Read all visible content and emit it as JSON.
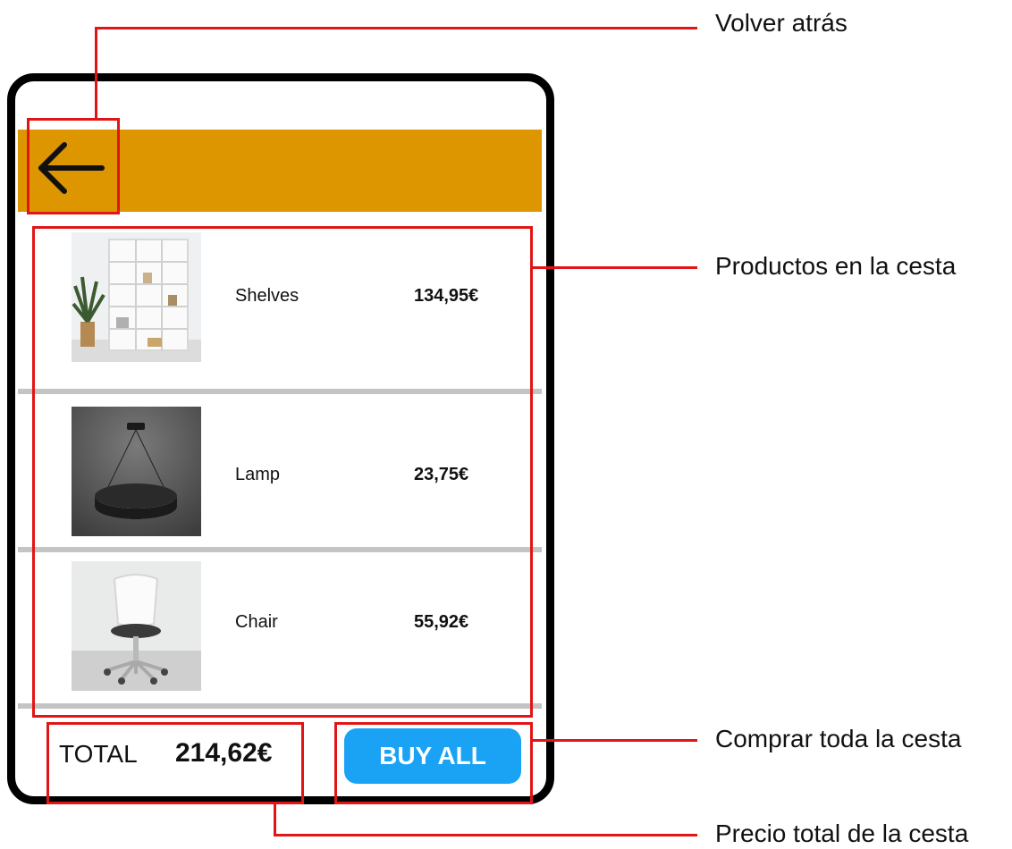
{
  "app": {
    "header_color": "#dd9500",
    "back_icon": "arrow-left-icon"
  },
  "cart": {
    "items": [
      {
        "name": "Shelves",
        "price": "134,95€",
        "image": "shelves-image"
      },
      {
        "name": "Lamp",
        "price": "23,75€",
        "image": "lamp-image"
      },
      {
        "name": "Chair",
        "price": "55,92€",
        "image": "chair-image"
      }
    ],
    "total_label": "TOTAL",
    "total_value": "214,62€",
    "buy_all_label": "BUY ALL",
    "buy_all_color": "#1aa3f5"
  },
  "annotations": {
    "back": "Volver atrás",
    "products": "Productos en la cesta",
    "buy_all": "Comprar toda la cesta",
    "total": "Precio total de la cesta",
    "color": "#e11515"
  }
}
